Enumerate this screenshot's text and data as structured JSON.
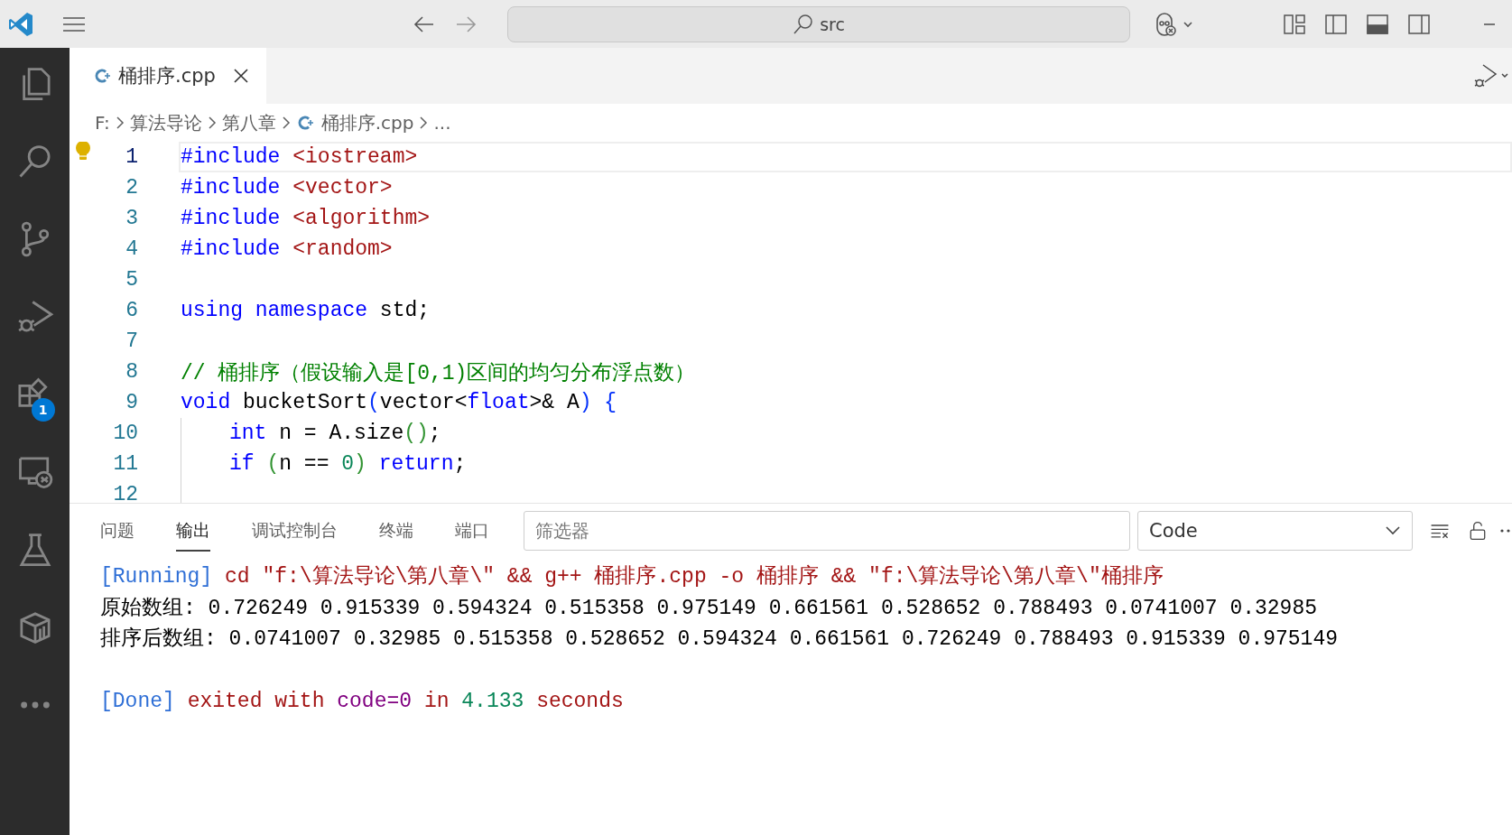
{
  "titlebar": {
    "search": {
      "value": "src"
    }
  },
  "activity_bar": {
    "items": [
      {
        "kind": "files"
      },
      {
        "kind": "search"
      },
      {
        "kind": "branch"
      },
      {
        "kind": "run"
      },
      {
        "kind": "extensions",
        "badge": "1"
      },
      {
        "kind": "remote"
      },
      {
        "kind": "flask"
      },
      {
        "kind": "box"
      },
      {
        "kind": "more"
      }
    ]
  },
  "tabs": [
    {
      "label": "桶排序.cpp",
      "selected": true
    }
  ],
  "breadcrumbs": [
    {
      "label": "F:",
      "kind": "folder"
    },
    {
      "label": "算法导论",
      "kind": "folder"
    },
    {
      "label": "第八章",
      "kind": "folder"
    },
    {
      "label": "桶排序.cpp",
      "kind": "file"
    },
    {
      "label": "...",
      "kind": "more"
    }
  ],
  "editor": {
    "lines": [
      {
        "number": "1",
        "current": true,
        "indent": false,
        "lightbulb": true,
        "tokens": [
          {
            "text": "#include",
            "kind": "dir"
          },
          {
            "text": " <iostream>",
            "kind": "str"
          }
        ]
      },
      {
        "number": "2",
        "current": false,
        "indent": false,
        "tokens": [
          {
            "text": "#include",
            "kind": "dir"
          },
          {
            "text": " <vector>",
            "kind": "str"
          }
        ]
      },
      {
        "number": "3",
        "current": false,
        "indent": false,
        "tokens": [
          {
            "text": "#include",
            "kind": "dir"
          },
          {
            "text": " <algorithm>",
            "kind": "str"
          }
        ]
      },
      {
        "number": "4",
        "current": false,
        "indent": false,
        "tokens": [
          {
            "text": "#include",
            "kind": "dir"
          },
          {
            "text": " <random>",
            "kind": "str"
          }
        ]
      },
      {
        "number": "5",
        "current": false,
        "indent": false
      },
      {
        "number": "6",
        "current": false,
        "indent": false,
        "tokens": [
          {
            "text": "using",
            "kind": "kw"
          },
          {
            "text": " namespace",
            "kind": "kw"
          },
          {
            "text": " std;",
            "kind": "plain"
          }
        ]
      },
      {
        "number": "7",
        "current": false,
        "indent": false
      },
      {
        "number": "8",
        "current": false,
        "indent": false,
        "tokens": [
          {
            "text": "// 桶排序（假设输入是[0,1)区间的均匀分布浮点数）",
            "kind": "cmt"
          }
        ]
      },
      {
        "number": "9",
        "current": false,
        "indent": false,
        "tokens": [
          {
            "text": "void",
            "kind": "kw"
          },
          {
            "text": " bucketSort",
            "kind": "plain"
          },
          {
            "text": "(",
            "kind": "br1"
          },
          {
            "text": "vector<",
            "kind": "plain"
          },
          {
            "text": "float",
            "kind": "kw"
          },
          {
            "text": ">& A",
            "kind": "plain"
          },
          {
            "text": ") {",
            "kind": "br1"
          }
        ]
      },
      {
        "number": "10",
        "current": false,
        "indent": true,
        "tokens": [
          {
            "text": "int",
            "kind": "kw"
          },
          {
            "text": " n = A.size",
            "kind": "plain"
          },
          {
            "text": "()",
            "kind": "br2"
          },
          {
            "text": ";",
            "kind": "plain"
          }
        ]
      },
      {
        "number": "11",
        "current": false,
        "indent": true,
        "tokens": [
          {
            "text": "if",
            "kind": "kw"
          },
          {
            "text": " (",
            "kind": "br2"
          },
          {
            "text": "n == ",
            "kind": "plain"
          },
          {
            "text": "0",
            "kind": "num"
          },
          {
            "text": ")",
            "kind": "br2"
          },
          {
            "text": " return",
            "kind": "kw"
          },
          {
            "text": ";",
            "kind": "plain"
          }
        ]
      },
      {
        "number": "12",
        "current": false,
        "indent": true
      }
    ]
  },
  "panel": {
    "tabs": [
      {
        "label": "问题",
        "selected": false
      },
      {
        "label": "输出",
        "selected": true
      },
      {
        "label": "调试控制台",
        "selected": false
      },
      {
        "label": "终端",
        "selected": false
      },
      {
        "label": "端口",
        "selected": false
      }
    ],
    "filter": {
      "placeholder": "筛选器"
    },
    "channel": {
      "value": "Code"
    },
    "output": [
      {
        "gap_before": false,
        "tokens": [
          {
            "text": "[Running]",
            "kind": "tag"
          },
          {
            "text": " cd \"f:\\算法导论\\第八章\\\" && g++ 桶排序.cpp -o 桶排序 && \"f:\\算法导论\\第八章\\\"桶排序",
            "kind": "red"
          }
        ]
      },
      {
        "gap_before": false,
        "tokens": [
          {
            "text": "原始数组: 0.726249 0.915339 0.594324 0.515358 0.975149 0.661561 0.528652 0.788493 0.0741007 0.32985",
            "kind": "plain"
          }
        ]
      },
      {
        "gap_before": false,
        "tokens": [
          {
            "text": "排序后数组: 0.0741007 0.32985 0.515358 0.528652 0.594324 0.661561 0.726249 0.788493 0.915339 0.975149",
            "kind": "plain"
          }
        ]
      },
      {
        "gap_before": true,
        "tokens": [
          {
            "text": "[Done]",
            "kind": "tag"
          },
          {
            "text": " exited with ",
            "kind": "red"
          },
          {
            "text": "code=0",
            "kind": "purple"
          },
          {
            "text": " in ",
            "kind": "red"
          },
          {
            "text": "4.133",
            "kind": "num"
          },
          {
            "text": " seconds",
            "kind": "red"
          }
        ]
      }
    ]
  }
}
